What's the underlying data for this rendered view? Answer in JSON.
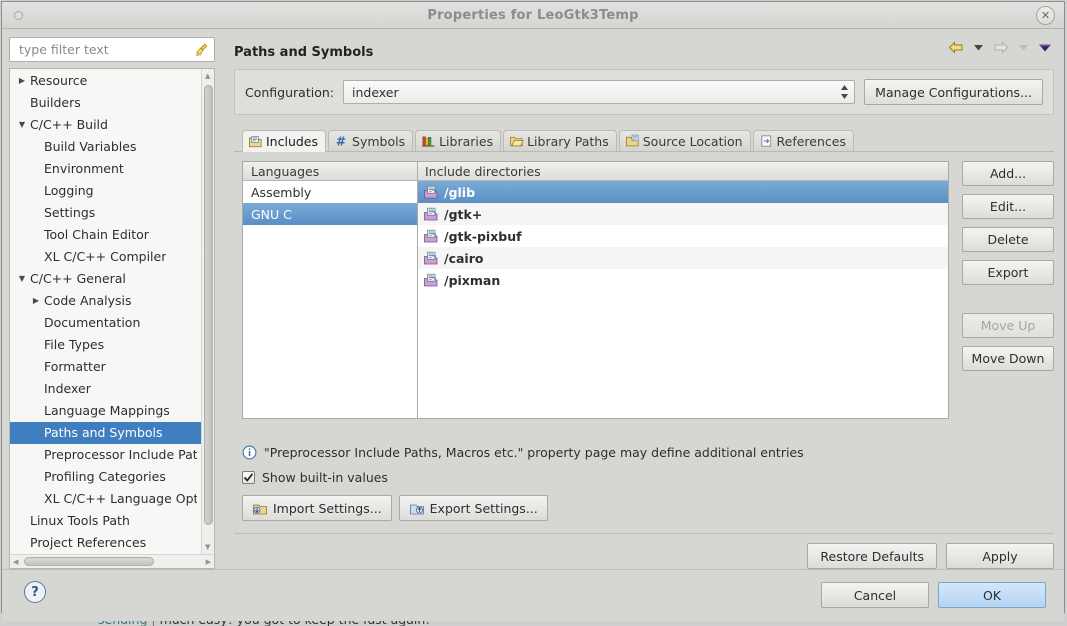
{
  "window": {
    "title": "Properties for LeoGtk3Temp",
    "close_icon": "close-icon"
  },
  "filter": {
    "placeholder": "type filter text",
    "value": "",
    "clear_icon": "broom-icon"
  },
  "sidebar": {
    "items": [
      {
        "label": "Resource",
        "indent": 0,
        "arrow": "collapsed",
        "selected": false
      },
      {
        "label": "Builders",
        "indent": 0,
        "arrow": "none",
        "selected": false
      },
      {
        "label": "C/C++ Build",
        "indent": 0,
        "arrow": "expanded",
        "selected": false
      },
      {
        "label": "Build Variables",
        "indent": 1,
        "arrow": "none",
        "selected": false
      },
      {
        "label": "Environment",
        "indent": 1,
        "arrow": "none",
        "selected": false
      },
      {
        "label": "Logging",
        "indent": 1,
        "arrow": "none",
        "selected": false
      },
      {
        "label": "Settings",
        "indent": 1,
        "arrow": "none",
        "selected": false
      },
      {
        "label": "Tool Chain Editor",
        "indent": 1,
        "arrow": "none",
        "selected": false
      },
      {
        "label": "XL C/C++ Compiler",
        "indent": 1,
        "arrow": "none",
        "selected": false
      },
      {
        "label": "C/C++ General",
        "indent": 0,
        "arrow": "expanded",
        "selected": false
      },
      {
        "label": "Code Analysis",
        "indent": 1,
        "arrow": "collapsed",
        "selected": false
      },
      {
        "label": "Documentation",
        "indent": 1,
        "arrow": "none",
        "selected": false
      },
      {
        "label": "File Types",
        "indent": 1,
        "arrow": "none",
        "selected": false
      },
      {
        "label": "Formatter",
        "indent": 1,
        "arrow": "none",
        "selected": false
      },
      {
        "label": "Indexer",
        "indent": 1,
        "arrow": "none",
        "selected": false
      },
      {
        "label": "Language Mappings",
        "indent": 1,
        "arrow": "none",
        "selected": false
      },
      {
        "label": "Paths and Symbols",
        "indent": 1,
        "arrow": "none",
        "selected": true
      },
      {
        "label": "Preprocessor Include Path",
        "indent": 1,
        "arrow": "none",
        "selected": false
      },
      {
        "label": "Profiling Categories",
        "indent": 1,
        "arrow": "none",
        "selected": false
      },
      {
        "label": "XL C/C++ Language Optio",
        "indent": 1,
        "arrow": "none",
        "selected": false
      },
      {
        "label": "Linux Tools Path",
        "indent": 0,
        "arrow": "none",
        "selected": false
      },
      {
        "label": "Project References",
        "indent": 0,
        "arrow": "none",
        "selected": false
      }
    ]
  },
  "page": {
    "title": "Paths and Symbols",
    "nav": {
      "back_icon": "back-arrow-icon",
      "back_menu_icon": "chevron-down-icon",
      "forward_icon": "forward-arrow-icon",
      "forward_menu_icon": "chevron-down-icon",
      "view_menu_icon": "view-menu-icon"
    }
  },
  "configuration": {
    "label": "Configuration:",
    "value": "indexer",
    "spinner_icon": "spinner-icon",
    "manage_label": "Manage Configurations..."
  },
  "tabs": [
    {
      "label": "Includes",
      "icon": "includes-icon",
      "active": true
    },
    {
      "label": "Symbols",
      "icon": "hash-icon",
      "active": false
    },
    {
      "label": "Libraries",
      "icon": "libraries-icon",
      "active": false
    },
    {
      "label": "Library Paths",
      "icon": "library-paths-icon",
      "active": false
    },
    {
      "label": "Source Location",
      "icon": "source-location-icon",
      "active": false
    },
    {
      "label": "References",
      "icon": "references-icon",
      "active": false
    }
  ],
  "languages": {
    "header": "Languages",
    "items": [
      {
        "label": "Assembly",
        "selected": false
      },
      {
        "label": "GNU C",
        "selected": true
      }
    ]
  },
  "include_directories": {
    "header": "Include directories",
    "items": [
      {
        "label": "/glib",
        "icon": "include-folder-icon",
        "selected": true
      },
      {
        "label": "/gtk+",
        "icon": "include-folder-icon",
        "selected": false
      },
      {
        "label": "/gtk-pixbuf",
        "icon": "include-folder-icon",
        "selected": false
      },
      {
        "label": "/cairo",
        "icon": "include-folder-icon",
        "selected": false
      },
      {
        "label": "/pixman",
        "icon": "include-folder-icon",
        "selected": false
      }
    ]
  },
  "side_buttons": [
    {
      "label": "Add...",
      "enabled": true
    },
    {
      "label": "Edit...",
      "enabled": true
    },
    {
      "label": "Delete",
      "enabled": true
    },
    {
      "label": "Export",
      "enabled": true
    },
    {
      "label": "Move Up",
      "enabled": false
    },
    {
      "label": "Move Down",
      "enabled": true
    }
  ],
  "notes": {
    "info_icon": "info-icon",
    "info_text": "\"Preprocessor Include Paths, Macros etc.\" property page may define additional entries",
    "checkbox_label": "Show built-in values",
    "checkbox_checked": true,
    "import_label": "Import Settings...",
    "import_icon": "import-icon",
    "export_label": "Export Settings...",
    "export_icon": "export-icon"
  },
  "apply_row": {
    "restore_label": "Restore Defaults",
    "apply_label": "Apply"
  },
  "footer": {
    "help_icon": "help-icon",
    "cancel_label": "Cancel",
    "ok_label": "OK"
  },
  "background": {
    "text_a": "sending",
    "text_b": "much easy! you got to keep the fast again!"
  },
  "colors": {
    "selection_blue": "#3f7fbf",
    "list_selection_blue": "#5a8fc4",
    "default_button_blue": "#b6d4f2",
    "dialog_bg": "#d6d6d2"
  }
}
